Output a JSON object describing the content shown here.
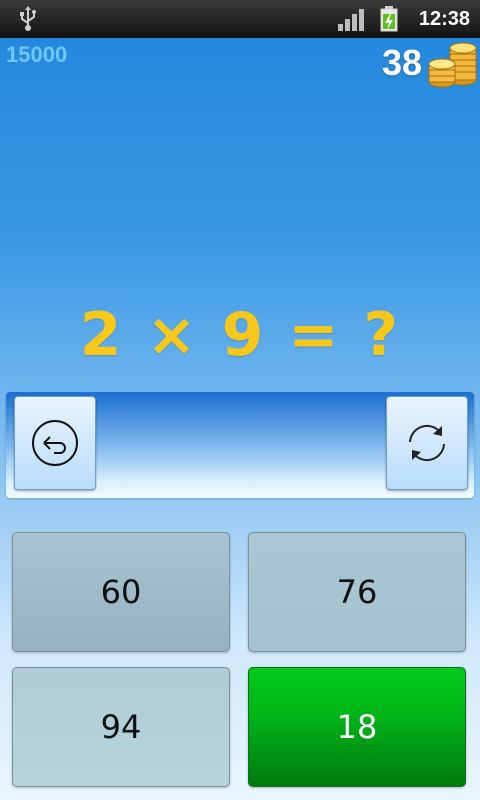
{
  "status_bar": {
    "time": "12:38",
    "icons": [
      "usb-icon",
      "signal-icon",
      "battery-charging-icon"
    ]
  },
  "score": "15000",
  "coins": {
    "count": "38",
    "icon": "coin-stack-icon"
  },
  "question": "2 × 9 = ?",
  "answer_panel": {
    "current_answer": "",
    "back_icon": "back-arrow-icon",
    "refresh_icon": "refresh-icon"
  },
  "options": [
    {
      "label": "60"
    },
    {
      "label": "76"
    },
    {
      "label": "94"
    },
    {
      "label": "18"
    }
  ],
  "colors": {
    "question": "#f7c81a",
    "score": "#6ec6ff",
    "correct_option": "#00b418"
  }
}
